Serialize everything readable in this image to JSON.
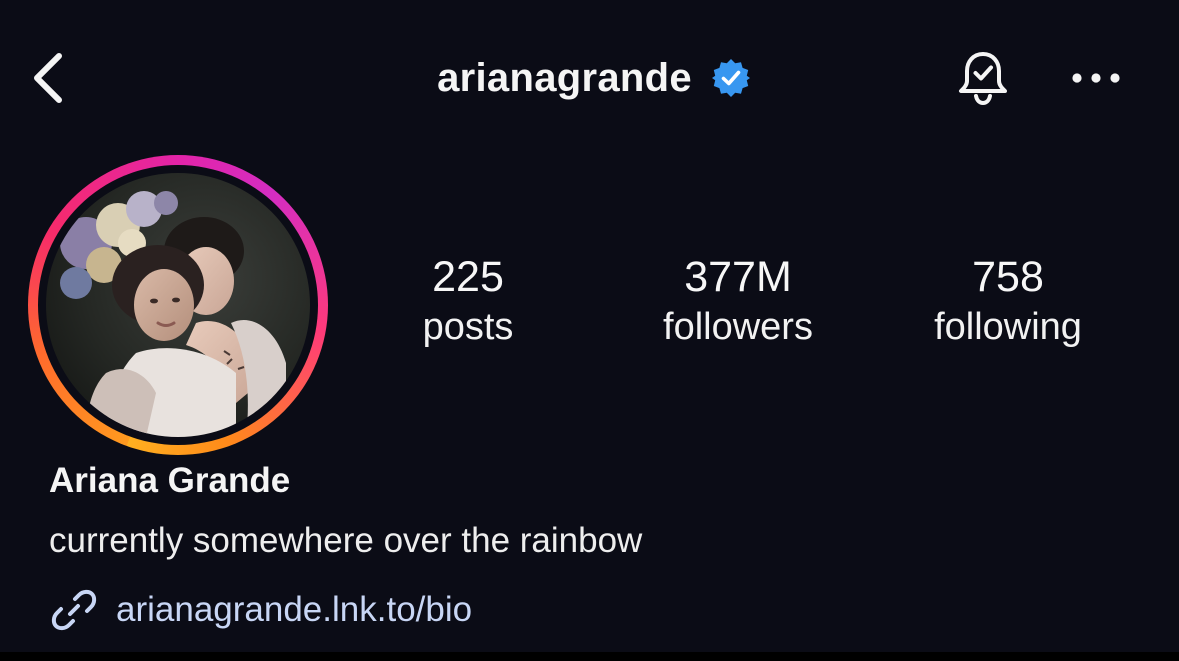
{
  "header": {
    "username": "arianagrande",
    "back_icon": "chevron-left-icon",
    "verified_icon": "verified-badge-icon",
    "bell_icon": "bell-check-icon",
    "more_icon": "more-horizontal-icon"
  },
  "profile": {
    "avatar": "profile-photo",
    "ring_colors": [
      "#ffb020",
      "#ff6b2c",
      "#f72b6a",
      "#d42dc2"
    ],
    "stats": {
      "posts_value": "225",
      "posts_label": "posts",
      "followers_value": "377M",
      "followers_label": "followers",
      "following_value": "758",
      "following_label": "following"
    },
    "display_name": "Ariana Grande",
    "bio": "currently somewhere over the rainbow",
    "link_icon": "link-icon",
    "link": "arianagrande.lnk.to/bio"
  },
  "colors": {
    "background": "#0b0c16",
    "verified_blue": "#3897f0",
    "link": "#c8d6f5"
  }
}
